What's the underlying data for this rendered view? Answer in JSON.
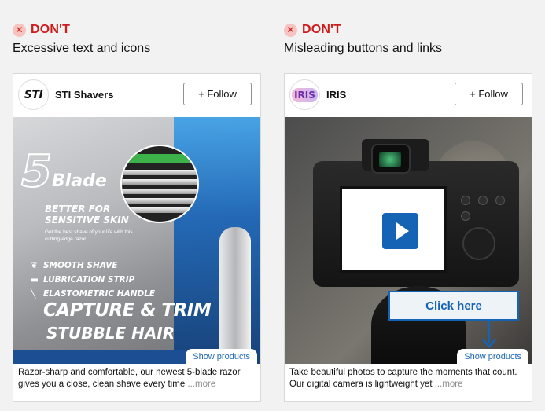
{
  "columns": [
    {
      "badge": {
        "icon": "x-circle-icon",
        "label": "DON'T"
      },
      "subtitle": "Excessive text and icons",
      "card": {
        "logo_text": "STI",
        "brand": "STI Shavers",
        "follow_label": "+ Follow",
        "media": {
          "five": "5",
          "blade_word": "Blade",
          "better_line1": "BETTER FOR",
          "better_line2": "SENSITIVE SKIN",
          "tagline": "Get the best shave of your life with this cutting-edge razor",
          "features": [
            "SMOOTH SHAVE",
            "LUBRICATION STRIP",
            "ELASTOMETRIC HANDLE"
          ],
          "headline1": "CAPTURE & TRIM",
          "headline2": "STUBBLE HAIR"
        },
        "show_products": "Show products",
        "caption": "Razor-sharp and comfortable, our newest 5-blade razor gives you a close, clean shave every time",
        "more": "...more"
      }
    },
    {
      "badge": {
        "icon": "x-circle-icon",
        "label": "DON'T"
      },
      "subtitle": "Misleading buttons and links",
      "card": {
        "logo_text": "IRIS",
        "brand": "IRIS",
        "follow_label": "+ Follow",
        "media": {
          "click_here": "Click here"
        },
        "show_products": "Show products",
        "caption": "Take beautiful photos to capture the moments that count. Our digital camera is lightweight yet",
        "more": "...more"
      }
    }
  ],
  "colors": {
    "dont_red": "#cc1c1c",
    "link_blue": "#1d67b4",
    "background": "#f2f2f2"
  }
}
